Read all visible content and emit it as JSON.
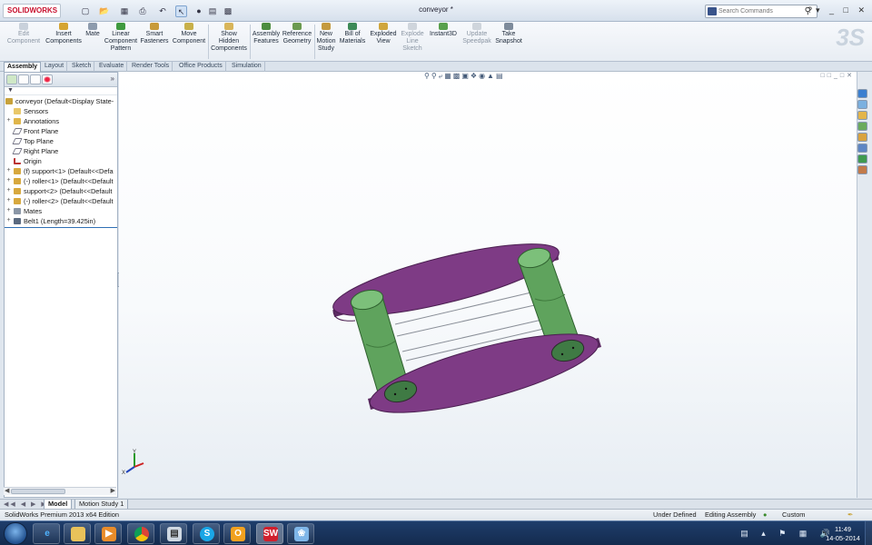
{
  "app": {
    "brand": "SOLIDWORKS",
    "document_title": "conveyor *",
    "search_placeholder": "Search Commands"
  },
  "quick_access": [
    "new-icon",
    "open-icon",
    "save-icon",
    "print-icon",
    "undo-icon",
    "select-icon",
    "rebuild-icon",
    "file-properties-icon",
    "options-icon"
  ],
  "command_manager": [
    {
      "label": "Edit\nComponent",
      "icon": "edit-component-icon",
      "enabled": false
    },
    {
      "label": "Insert\nComponents",
      "icon": "insert-components-icon",
      "enabled": true
    },
    {
      "label": "Mate",
      "icon": "mate-icon",
      "enabled": true
    },
    {
      "label": "Linear\nComponent\nPattern",
      "icon": "linear-pattern-icon",
      "enabled": true
    },
    {
      "label": "Smart\nFasteners",
      "icon": "smart-fasteners-icon",
      "enabled": true
    },
    {
      "label": "Move\nComponent",
      "icon": "move-component-icon",
      "enabled": true
    },
    {
      "label": "Show\nHidden\nComponents",
      "icon": "show-hidden-icon",
      "enabled": true
    },
    {
      "label": "Assembly\nFeatures",
      "icon": "assembly-features-icon",
      "enabled": true
    },
    {
      "label": "Reference\nGeometry",
      "icon": "reference-geometry-icon",
      "enabled": true
    },
    {
      "label": "New\nMotion\nStudy",
      "icon": "motion-study-icon",
      "enabled": true
    },
    {
      "label": "Bill of\nMaterials",
      "icon": "bom-icon",
      "enabled": true
    },
    {
      "label": "Exploded\nView",
      "icon": "exploded-view-icon",
      "enabled": true
    },
    {
      "label": "Explode\nLine\nSketch",
      "icon": "explode-line-icon",
      "enabled": false
    },
    {
      "label": "Instant3D",
      "icon": "instant3d-icon",
      "enabled": true
    },
    {
      "label": "Update\nSpeedpak",
      "icon": "speedpak-icon",
      "enabled": false
    },
    {
      "label": "Take\nSnapshot",
      "icon": "snapshot-icon",
      "enabled": true
    }
  ],
  "tabs": [
    "Assembly",
    "Layout",
    "Sketch",
    "Evaluate",
    "Render Tools",
    "Office Products",
    "Simulation"
  ],
  "active_tab": "Assembly",
  "feature_tree": {
    "root": "conveyor  (Default<Display State-",
    "items": [
      {
        "label": "Sensors",
        "icon": "sensors-icon",
        "expand": ""
      },
      {
        "label": "Annotations",
        "icon": "annotations-icon",
        "expand": "+"
      },
      {
        "label": "Front Plane",
        "icon": "plane-icon",
        "expand": ""
      },
      {
        "label": "Top Plane",
        "icon": "plane-icon",
        "expand": ""
      },
      {
        "label": "Right Plane",
        "icon": "plane-icon",
        "expand": ""
      },
      {
        "label": "Origin",
        "icon": "origin-icon",
        "expand": ""
      },
      {
        "label": "(f) support<1> (Default<<Defa",
        "icon": "part-icon",
        "expand": "+"
      },
      {
        "label": "(-) roller<1> (Default<<Default",
        "icon": "part-icon",
        "expand": "+"
      },
      {
        "label": "support<2> (Default<<Default",
        "icon": "part-icon",
        "expand": "+"
      },
      {
        "label": "(-) roller<2> (Default<<Default",
        "icon": "part-icon",
        "expand": "+"
      },
      {
        "label": "Mates",
        "icon": "mates-icon",
        "expand": "+"
      },
      {
        "label": "Belt1 (Length=39.425in)",
        "icon": "belt-icon",
        "expand": "+"
      }
    ]
  },
  "bottom_tabs": [
    "Model",
    "Motion Study 1"
  ],
  "status": {
    "edition": "SolidWorks Premium 2013 x64 Edition",
    "defined": "Under Defined",
    "editing": "Editing Assembly",
    "units": "Custom"
  },
  "taskbar": {
    "apps": [
      "ie-icon",
      "file-explorer-icon",
      "media-player-icon",
      "chrome-icon",
      "notes-icon",
      "skype-icon",
      "outlook-icon",
      "solidworks-icon",
      "paint-icon"
    ],
    "time": "11:49",
    "date": "14-05-2014"
  },
  "colors": {
    "support_plate": "#7e3b85",
    "roller": "#5fa35d",
    "viewport_bg": "#ffffff"
  }
}
